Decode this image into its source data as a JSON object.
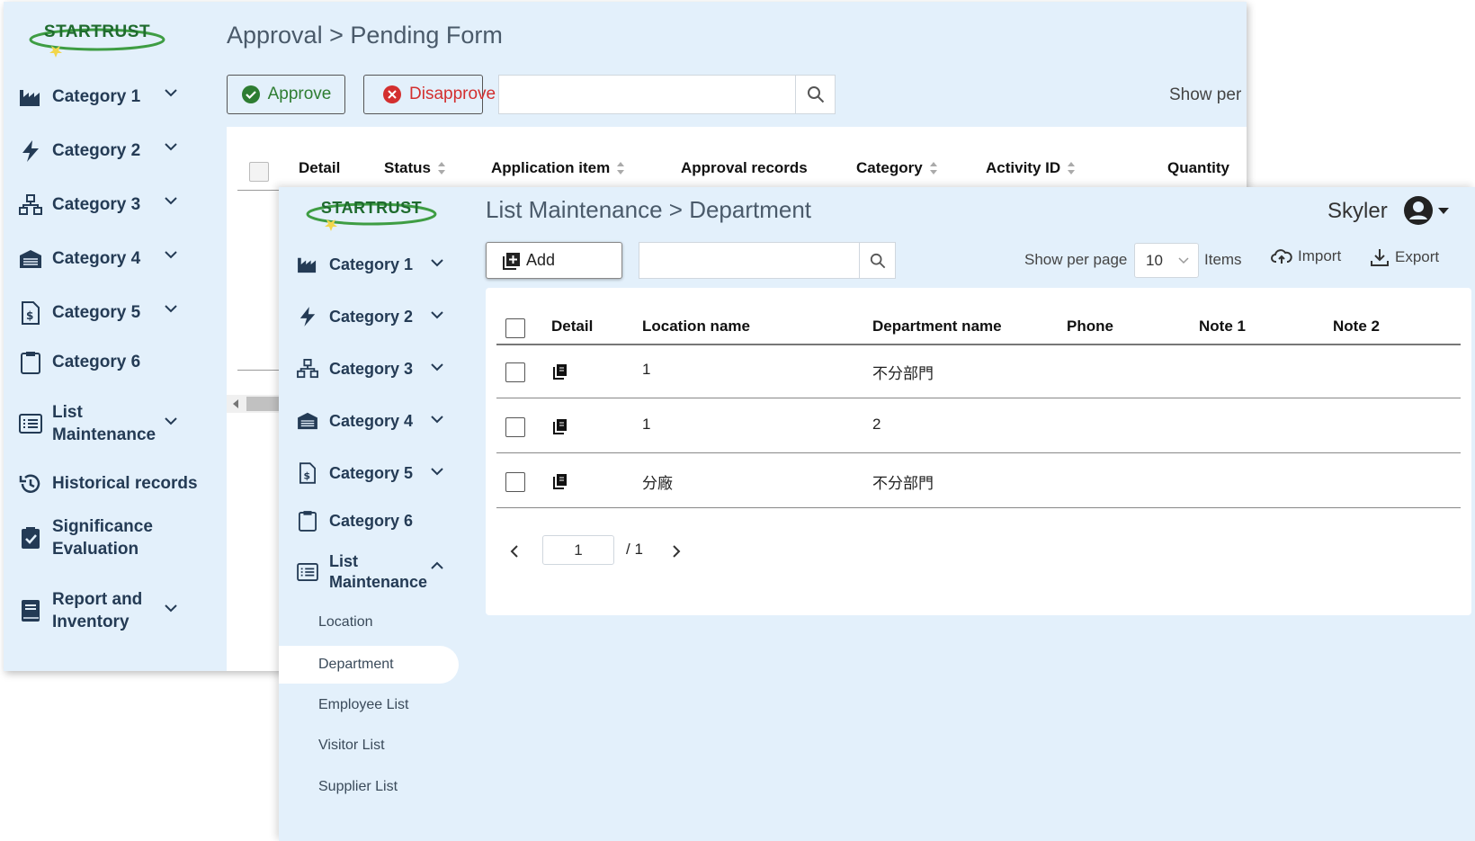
{
  "logo_text": "STARTRUST",
  "back_window": {
    "breadcrumb": "Approval > Pending Form",
    "approve_label": "Approve",
    "disapprove_label": "Disapprove",
    "show_per_label": "Show per",
    "sidebar": [
      {
        "label": "Category 1"
      },
      {
        "label": "Category 2"
      },
      {
        "label": "Category 3"
      },
      {
        "label": "Category 4"
      },
      {
        "label": "Category 5"
      },
      {
        "label": "Category 6"
      },
      {
        "label_line1": "List",
        "label_line2": "Maintenance"
      },
      {
        "label": "Historical records"
      },
      {
        "label_line1": "Significance",
        "label_line2": "Evaluation"
      },
      {
        "label_line1": "Report and",
        "label_line2": "Inventory"
      }
    ],
    "columns": [
      "Detail",
      "Status",
      "Application item",
      "Approval records",
      "Category",
      "Activity ID",
      "Quantity"
    ]
  },
  "front_window": {
    "breadcrumb": "List Maintenance > Department",
    "user_name": "Skyler",
    "add_label": "Add",
    "show_per_page_label": "Show per page",
    "per_page_value": "10",
    "items_label": "Items",
    "import_label": "Import",
    "export_label": "Export",
    "sidebar": [
      {
        "label": "Category 1"
      },
      {
        "label": "Category 2"
      },
      {
        "label": "Category 3"
      },
      {
        "label": "Category 4"
      },
      {
        "label": "Category 5"
      },
      {
        "label": "Category 6"
      },
      {
        "label_line1": "List",
        "label_line2": "Maintenance"
      }
    ],
    "submenu": [
      "Location",
      "Department",
      "Employee List",
      "Visitor List",
      "Supplier List"
    ],
    "columns": [
      "Detail",
      "Location name",
      "Department name",
      "Phone",
      "Note 1",
      "Note 2"
    ],
    "rows": [
      {
        "location": "1",
        "department": "不分部門",
        "phone": "",
        "note1": "",
        "note2": ""
      },
      {
        "location": "1",
        "department": "2",
        "phone": "",
        "note1": "",
        "note2": ""
      },
      {
        "location": "分廠",
        "department": "不分部門",
        "phone": "",
        "note1": "",
        "note2": ""
      }
    ],
    "pagination": {
      "current": "1",
      "total_text": "/ 1"
    }
  },
  "colors": {
    "background": "#e3f0fb",
    "panel": "#ffffff",
    "accent": "#1f6b2e",
    "approve": "#2e7d32",
    "disapprove": "#d32f2f"
  }
}
